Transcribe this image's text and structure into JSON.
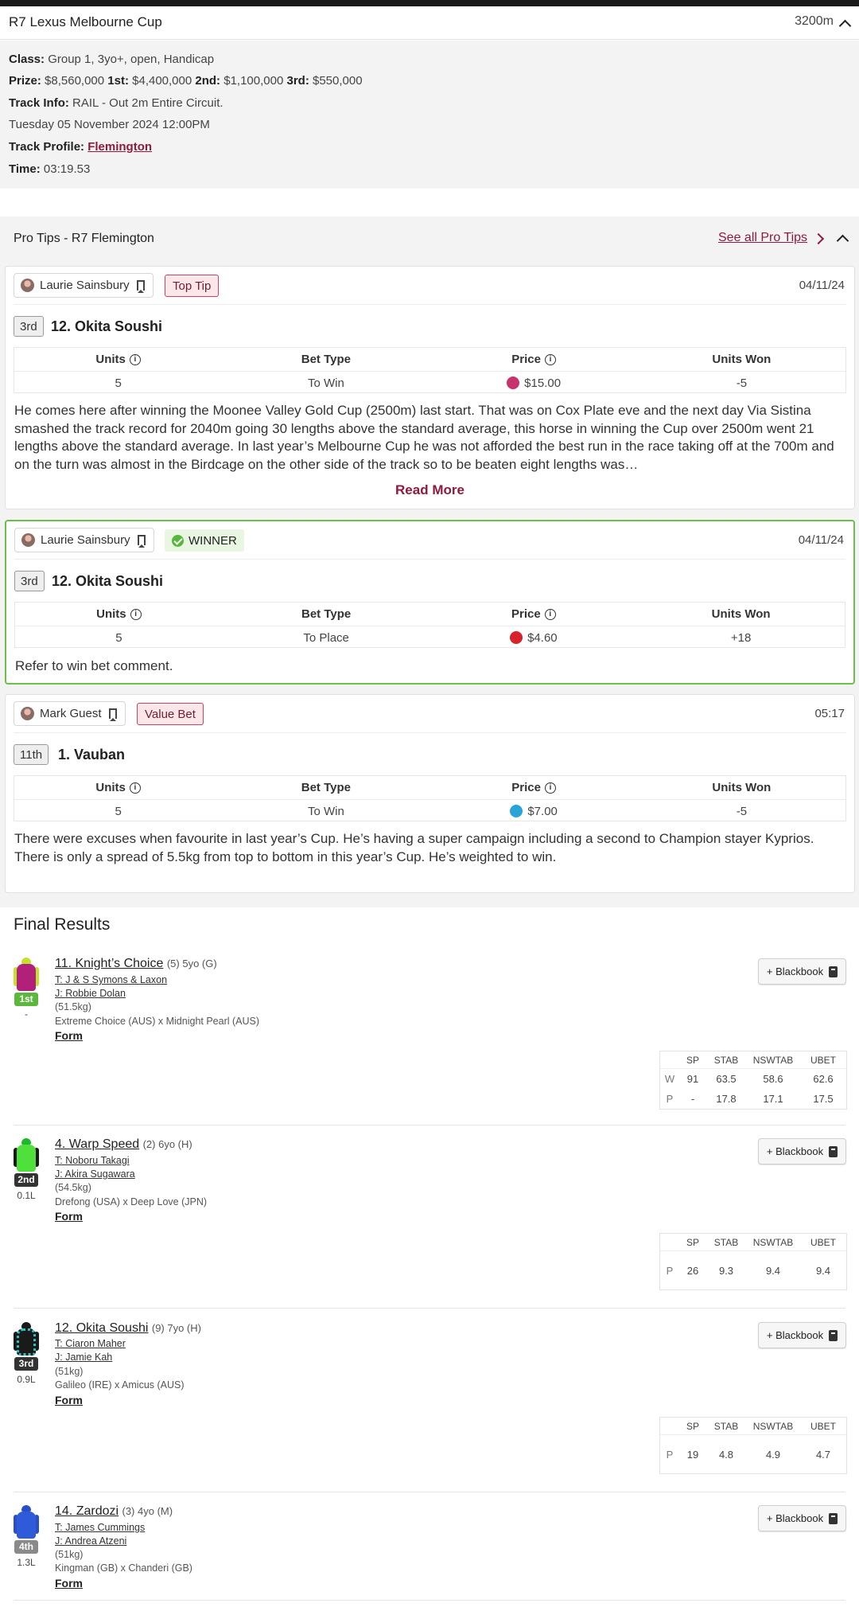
{
  "race": {
    "title": "R7 Lexus Melbourne Cup",
    "distance": "3200m",
    "class_label": "Class:",
    "class_value": "Group 1, 3yo+, open, Handicap",
    "prize_label": "Prize:",
    "prize_value": "$8,560,000",
    "first_label": "1st:",
    "first_value": "$4,400,000",
    "second_label": "2nd:",
    "second_value": "$1,100,000",
    "third_label": "3rd:",
    "third_value": "$550,000",
    "track_info_label": "Track Info:",
    "track_info_value": "RAIL - Out 2m Entire Circuit.",
    "date": "Tuesday 05 November 2024 12:00PM",
    "track_profile_label": "Track Profile:",
    "track_profile_value": "Flemington",
    "time_label": "Time:",
    "time_value": "03:19.53"
  },
  "pro_tips": {
    "title": "Pro Tips - R7 Flemington",
    "see_all": "See all Pro Tips",
    "headers": {
      "units": "Units",
      "bet_type": "Bet Type",
      "price": "Price",
      "units_won": "Units Won"
    },
    "tips": [
      {
        "tipster": "Laurie Sainsbury",
        "tag": "Top Tip",
        "date": "04/11/24",
        "position": "3rd",
        "horse": "12. Okita Soushi",
        "units": "5",
        "bet_type": "To Win",
        "price": "$15.00",
        "units_won": "-5",
        "comment": "He comes here after winning the Moonee Valley Gold Cup (2500m) last start. That was on Cox Plate eve and the next day Via Sistina smashed the track record for 2040m going 30 lengths above the standard average, this horse in winning the Cup over 2500m went 21 lengths above the standard average. In last year’s Melbourne Cup he was not afforded the best run in the race taking off at the 700m and on the turn was almost in the Birdcage on the other side of the track so to be beaten eight lengths was…",
        "read_more": "Read More",
        "bookie_color": "#c8336f"
      },
      {
        "tipster": "Laurie Sainsbury",
        "tag": "WINNER",
        "date": "04/11/24",
        "position": "3rd",
        "horse": "12. Okita Soushi",
        "units": "5",
        "bet_type": "To Place",
        "price": "$4.60",
        "units_won": "+18",
        "comment": "Refer to win bet comment.",
        "bookie_color": "#d8232a"
      },
      {
        "tipster": "Mark Guest",
        "tag": "Value Bet",
        "date": "05:17",
        "position": "11th",
        "horse": "1. Vauban",
        "units": "5",
        "bet_type": "To Win",
        "price": "$7.00",
        "units_won": "-5",
        "comment": "There were excuses when favourite in last year’s Cup. He’s having a super campaign including a second to Champion stayer Kyprios. There is only a spread of 5.5kg from top to bottom in this year’s Cup. He’s weighted to win.",
        "bookie_color": "#2aa3d8"
      }
    ]
  },
  "final_results": {
    "title": "Final Results",
    "blackbook_label": "+ Blackbook",
    "form_label": "Form",
    "odds_headers": {
      "sp": "SP",
      "stab": "STAB",
      "nswtab": "NSWTAB",
      "ubet": "UBET"
    },
    "runners": [
      {
        "place": "1st",
        "margin": "-",
        "name": "11. Knight’s Choice",
        "meta": "(5) 5yo (G)",
        "trainer": "T: J & S Symons & Laxon",
        "jockey": "J: Robbie Dolan",
        "weight": "(51.5kg)",
        "breeding": "Extreme Choice (AUS) x Midnight Pearl (AUS)",
        "badge_color": "#5cb83c",
        "odds": [
          {
            "type": "W",
            "sp": "91",
            "stab": "63.5",
            "nswtab": "58.6",
            "ubet": "62.6"
          },
          {
            "type": "P",
            "sp": "-",
            "stab": "17.8",
            "nswtab": "17.1",
            "ubet": "17.5"
          }
        ]
      },
      {
        "place": "2nd",
        "margin": "0.1L",
        "name": "4. Warp Speed",
        "meta": "(2) 6yo (H)",
        "trainer": "T: Noboru Takagi",
        "jockey": "J: Akira Sugawara",
        "weight": "(54.5kg)",
        "breeding": "Drefong (USA) x Deep Love (JPN)",
        "badge_color": "#333333",
        "odds": [
          {
            "type": "P",
            "sp": "26",
            "stab": "9.3",
            "nswtab": "9.4",
            "ubet": "9.4"
          }
        ]
      },
      {
        "place": "3rd",
        "margin": "0.9L",
        "name": "12. Okita Soushi",
        "meta": "(9) 7yo (H)",
        "trainer": "T: Ciaron Maher",
        "jockey": "J: Jamie Kah",
        "weight": "(51kg)",
        "breeding": "Galileo (IRE) x Amicus (AUS)",
        "badge_color": "#333333",
        "odds": [
          {
            "type": "P",
            "sp": "19",
            "stab": "4.8",
            "nswtab": "4.9",
            "ubet": "4.7"
          }
        ]
      },
      {
        "place": "4th",
        "margin": "1.3L",
        "name": "14. Zardozi",
        "meta": "(3) 4yo (M)",
        "trainer": "T: James Cummings",
        "jockey": "J: Andrea Atzeni",
        "weight": "(51kg)",
        "breeding": "Kingman (GB) x Chanderi (GB)",
        "badge_color": "#8a8a8a"
      }
    ]
  }
}
